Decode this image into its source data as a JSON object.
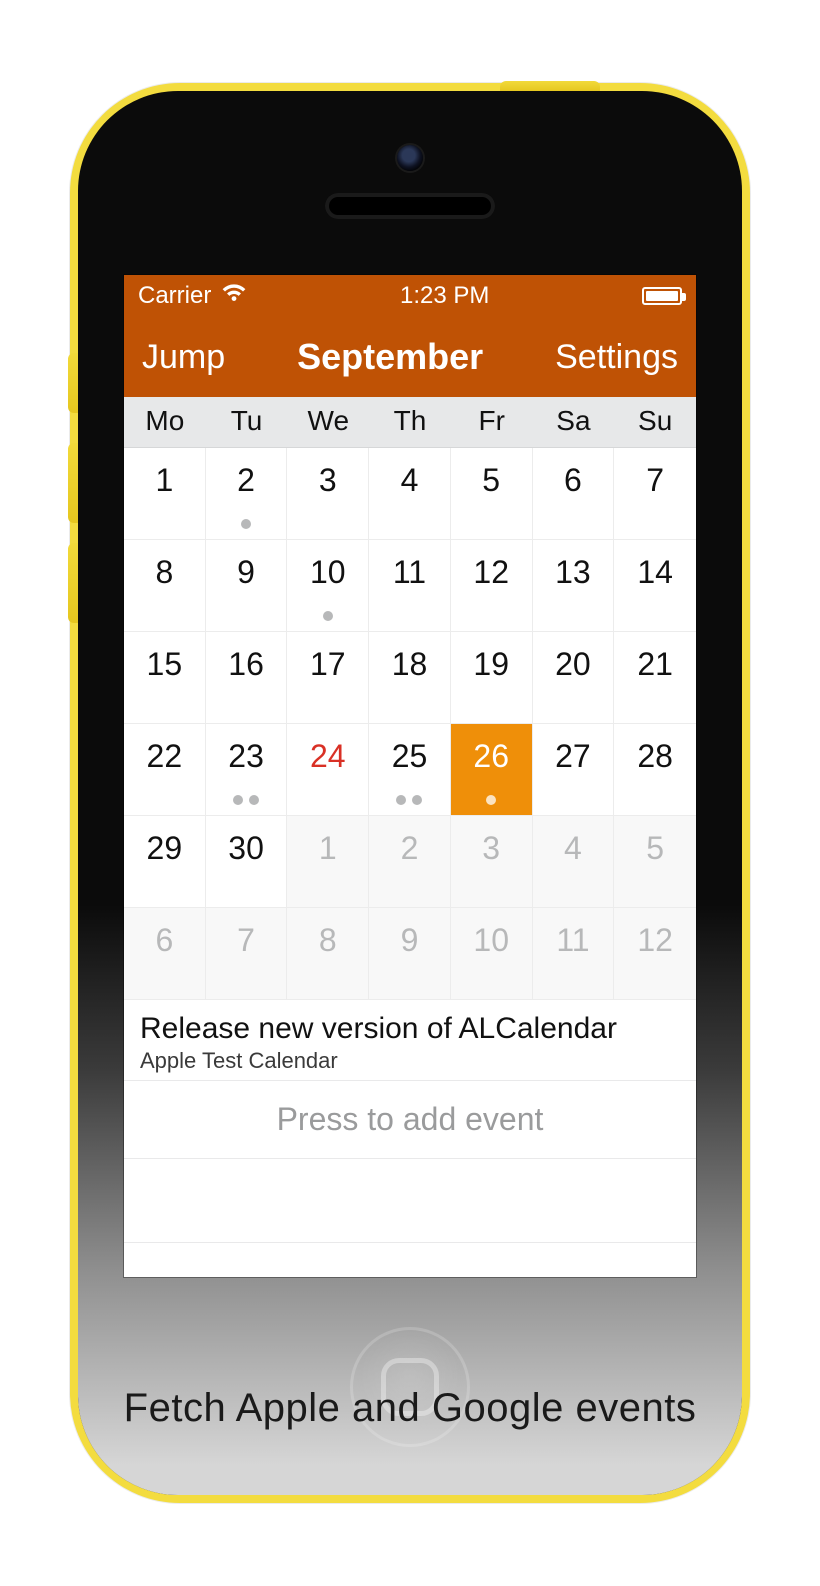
{
  "status": {
    "carrier": "Carrier",
    "time": "1:23 PM"
  },
  "nav": {
    "left": "Jump",
    "title": "September",
    "right": "Settings"
  },
  "weekdays": [
    "Mo",
    "Tu",
    "We",
    "Th",
    "Fr",
    "Sa",
    "Su"
  ],
  "grid": [
    [
      {
        "n": "1"
      },
      {
        "n": "2",
        "dots": 1
      },
      {
        "n": "3"
      },
      {
        "n": "4"
      },
      {
        "n": "5"
      },
      {
        "n": "6"
      },
      {
        "n": "7"
      }
    ],
    [
      {
        "n": "8"
      },
      {
        "n": "9"
      },
      {
        "n": "10",
        "dots": 1
      },
      {
        "n": "11"
      },
      {
        "n": "12"
      },
      {
        "n": "13"
      },
      {
        "n": "14"
      }
    ],
    [
      {
        "n": "15"
      },
      {
        "n": "16"
      },
      {
        "n": "17"
      },
      {
        "n": "18"
      },
      {
        "n": "19"
      },
      {
        "n": "20"
      },
      {
        "n": "21"
      }
    ],
    [
      {
        "n": "22"
      },
      {
        "n": "23",
        "dots": 2
      },
      {
        "n": "24",
        "today": true
      },
      {
        "n": "25",
        "dots": 2
      },
      {
        "n": "26",
        "dots": 1,
        "selected": true
      },
      {
        "n": "27"
      },
      {
        "n": "28"
      }
    ],
    [
      {
        "n": "29"
      },
      {
        "n": "30"
      },
      {
        "n": "1",
        "out": true
      },
      {
        "n": "2",
        "out": true
      },
      {
        "n": "3",
        "out": true
      },
      {
        "n": "4",
        "out": true
      },
      {
        "n": "5",
        "out": true
      }
    ],
    [
      {
        "n": "6",
        "out": true
      },
      {
        "n": "7",
        "out": true
      },
      {
        "n": "8",
        "out": true
      },
      {
        "n": "9",
        "out": true
      },
      {
        "n": "10",
        "out": true
      },
      {
        "n": "11",
        "out": true
      },
      {
        "n": "12",
        "out": true
      }
    ]
  ],
  "events": [
    {
      "title": "Release new version of ALCalendar",
      "calendar": "Apple Test Calendar"
    }
  ],
  "add_event": "Press to add event",
  "caption": "Fetch  Apple and Google events"
}
